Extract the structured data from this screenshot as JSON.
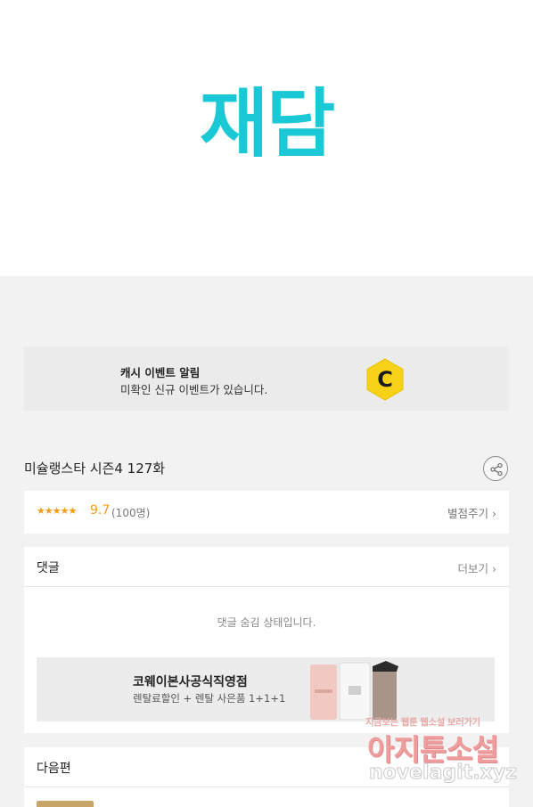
{
  "brand": {
    "logo_text": "재담",
    "logo_color": "#1bc9d6"
  },
  "cash_banner": {
    "title": "캐시 이벤트 알림",
    "subtitle": "미확인 신규 이벤트가 있습니다.",
    "coin_letter": "C",
    "coin_color": "#f7d117"
  },
  "episode": {
    "title": "미슐랭스타 시즌4 127화",
    "share_icon": "share-icon"
  },
  "rating": {
    "stars": "★★★★★",
    "score": "9.7",
    "count": "(100명)",
    "rate_label": "별점주기 ›",
    "accent": "#f39c12"
  },
  "comments": {
    "title": "댓글",
    "more_label": "더보기 ›",
    "hidden_notice": "댓글 숨김 상태입니다."
  },
  "ad": {
    "title": "코웨이본사공식직영점",
    "subtitle": "렌탈료할인 + 렌탈 사은품 1+1+1"
  },
  "next": {
    "title": "다음편"
  },
  "watermark": {
    "top": "지금보는 웹툰 웹소설 보러가기",
    "main": "아지툰소설",
    "url": "novelagit.xyz"
  }
}
